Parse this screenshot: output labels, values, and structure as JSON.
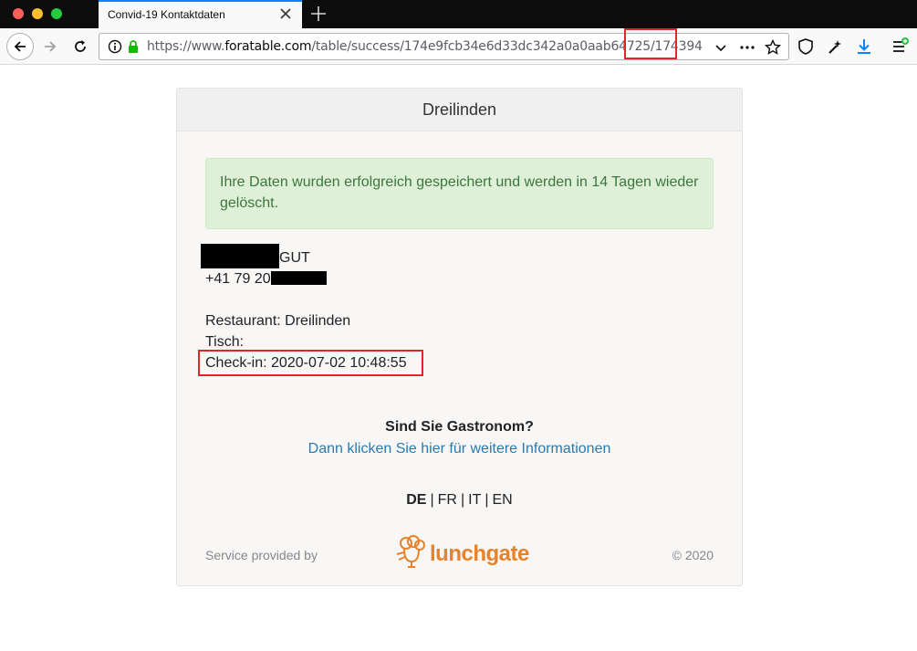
{
  "browser": {
    "tab_title": "Convid-19 Kontaktdaten",
    "url_prefix": "https://www.",
    "url_domain": "foratable.com",
    "url_path": "/table/success/174e9fcb34e6d33dc342a0a0aab64725/",
    "url_id": "174394",
    "icons": [
      "back-arrow-icon",
      "forward-arrow-icon",
      "reload-icon",
      "info-icon",
      "lock-icon",
      "chevron-down-icon",
      "more-dots-icon",
      "star-icon",
      "shield-icon",
      "customize-icon",
      "download-icon",
      "menu-icon"
    ]
  },
  "page": {
    "header_title": "Dreilinden",
    "alert_text": "Ihre Daten wurden erfolgreich gespeichert und werden in 14 Tagen wieder gelöscht.",
    "name_suffix": "GUT",
    "phone_prefix": "+41 79 20",
    "restaurant_line": "Restaurant: Dreilinden",
    "table_line": "Tisch:",
    "checkin_line": "Check-in: 2020-07-02 10:48:55",
    "gastro_question": "Sind Sie Gastronom?",
    "gastro_link": "Dann klicken Sie hier für weitere Informationen",
    "languages": {
      "active": "DE",
      "others": [
        "FR",
        "IT",
        "EN"
      ],
      "separator": "|"
    },
    "footer_left": "Service provided by",
    "logo_text": "lunchgate",
    "footer_right": "© 2020"
  },
  "colors": {
    "accent": "#0a84ff",
    "alert_bg": "#dff0d8",
    "alert_text": "#3c763d",
    "link": "#2a7ab0",
    "highlight": "#e0262a",
    "logo": "#e8822a"
  }
}
